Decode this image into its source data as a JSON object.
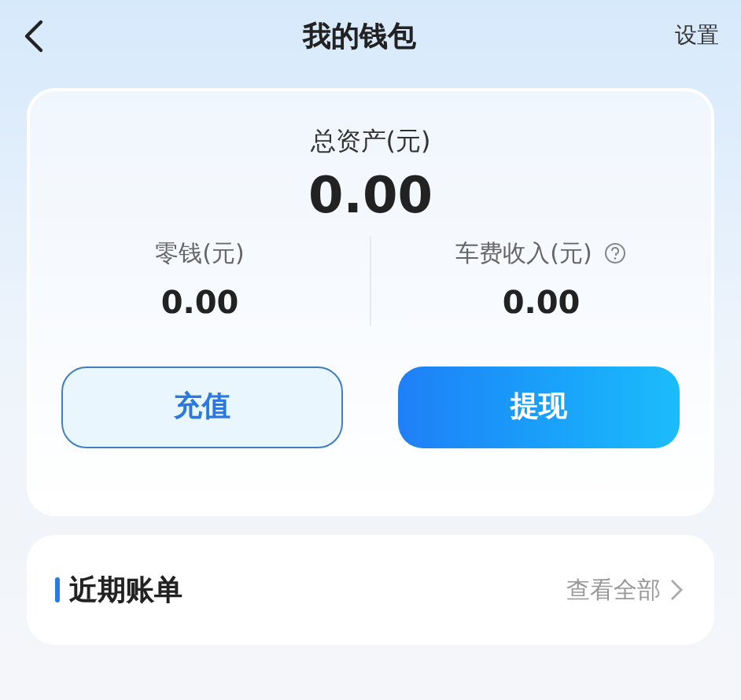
{
  "header": {
    "title": "我的钱包",
    "action": "设置"
  },
  "summary": {
    "total_label": "总资产(元)",
    "total_value": "0.00",
    "items": [
      {
        "label": "零钱(元)",
        "value": "0.00",
        "help": false
      },
      {
        "label": "车费收入(元)",
        "value": "0.00",
        "help": true
      }
    ],
    "buttons": [
      {
        "label": "充值",
        "kind": "outline"
      },
      {
        "label": "提现",
        "kind": "primary"
      }
    ]
  },
  "bills": {
    "title": "近期账单",
    "link": "查看全部"
  }
}
